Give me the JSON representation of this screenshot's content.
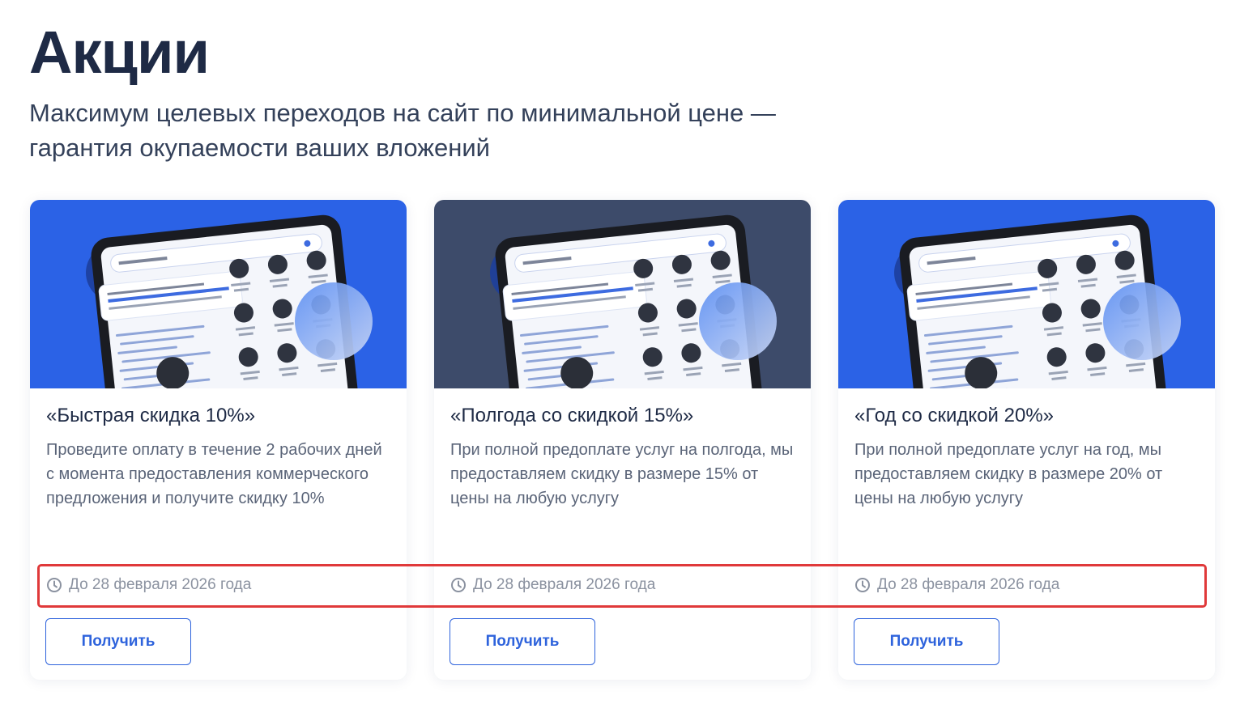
{
  "page": {
    "title": "Акции",
    "subtitle": "Максимум целевых переходов на сайт по минимальной цене — гарантия окупаемости ваших вложений"
  },
  "colors": {
    "accent": "#2e63dc",
    "highlight": "#e0393a",
    "card_bg_blue": "#2b62e6",
    "card_bg_slate": "#3d4b6a"
  },
  "cards": [
    {
      "title": "«Быстрая скидка 10%»",
      "description": "Проведите оплату в течение 2 рабочих дней с момента предоставления коммерческого предложения и получите скидку 10%",
      "deadline": "До 28 февраля 2026 года",
      "button_label": "Получить",
      "image_theme": "blue"
    },
    {
      "title": "«Полгода со скидкой 15%»",
      "description": "При полной предоплате услуг на полгода, мы предоставляем скидку в размере 15% от цены на любую услугу",
      "deadline": "До 28 февраля 2026 года",
      "button_label": "Получить",
      "image_theme": "slate"
    },
    {
      "title": "«Год со скидкой 20%»",
      "description": "При полной предоплате услуг на год, мы предоставляем скидку в размере 20% от цены на любую услугу",
      "deadline": "До 28 февраля 2026 года",
      "button_label": "Получить",
      "image_theme": "blue"
    }
  ]
}
